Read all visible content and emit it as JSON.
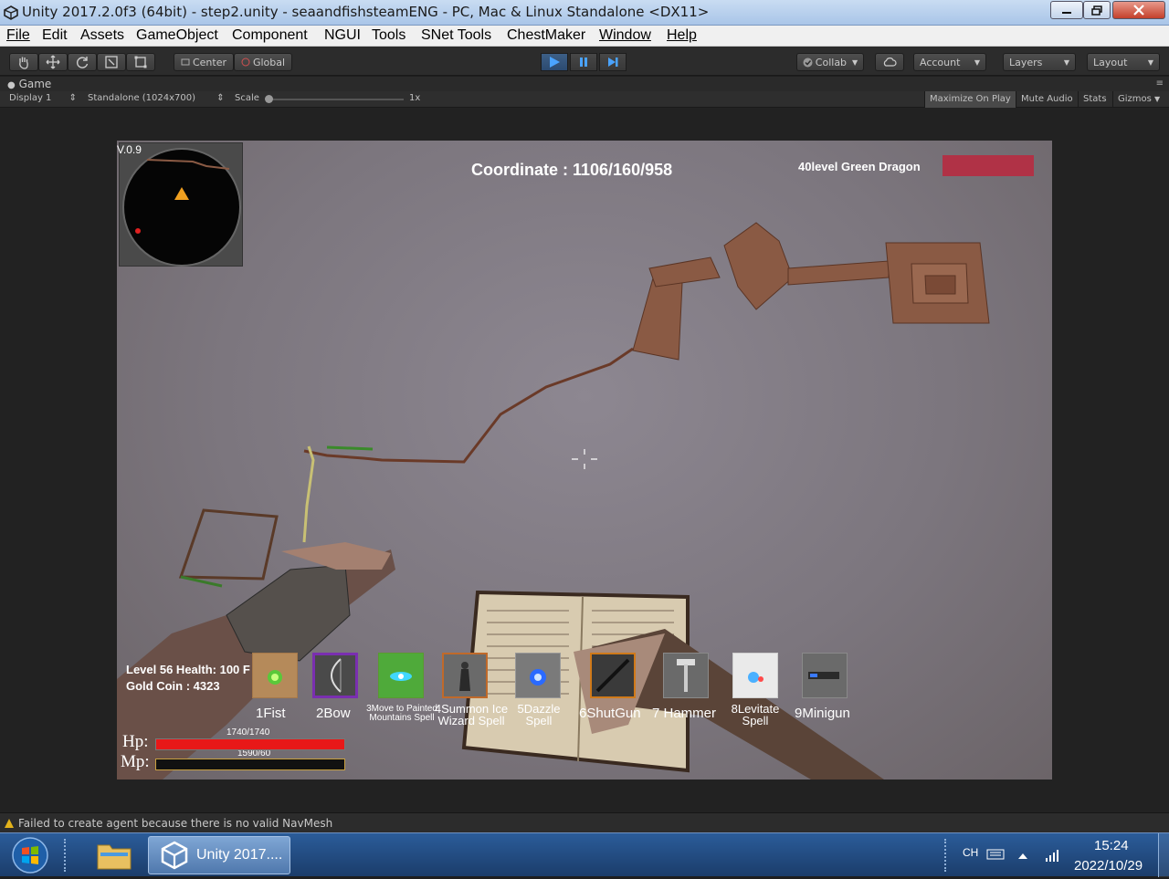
{
  "window": {
    "title": "Unity 2017.2.0f3 (64bit) - step2.unity - seaandfishsteamENG - PC, Mac & Linux Standalone <DX11>",
    "buttons": [
      "minimize",
      "maximize",
      "close"
    ]
  },
  "menu": [
    "File",
    "Edit",
    "Assets",
    "GameObject",
    "Component",
    "NGUI",
    "Tools",
    "SNet Tools",
    "ChestMaker",
    "Window",
    "Help"
  ],
  "toolbar": {
    "pivot": "Center",
    "space": "Global",
    "collab": "Collab",
    "account": "Account",
    "layers": "Layers",
    "layout": "Layout"
  },
  "game_view": {
    "tab": "Game",
    "display": "Display 1",
    "resolution": "Standalone (1024x700)",
    "scale_label": "Scale",
    "scale_value": "1x",
    "maximize_on_play": "Maximize On Play",
    "mute_audio": "Mute Audio",
    "stats": "Stats",
    "gizmos": "Gizmos"
  },
  "hud": {
    "version": "V.0.9",
    "coordinate": "Coordinate : 1106/160/958",
    "enemy": "40level Green Dragon",
    "enemy_health_color": "#b03246",
    "level_health": "Level 56 Health: 100 F",
    "gold": "Gold Coin : 4323",
    "hp_label": "Hp:",
    "mp_label": "Mp:",
    "hp_value": "1740/1740",
    "mp_value": "1590/60",
    "hp_fraction": 1.0,
    "mp_fraction": 0.0,
    "hp_color": "#e81818",
    "mp_color": "#1a2a9a",
    "slots": [
      {
        "label": "1Fist",
        "border": "#a6794a"
      },
      {
        "label": "2Bow",
        "border": "#7a2fb0"
      },
      {
        "label": "3Move to Painted Mountains Spell",
        "border": "#5a9a30"
      },
      {
        "label": "4Summon Ice Wizard Spell",
        "border": "#c06a2a"
      },
      {
        "label": "5Dazzle Spell",
        "border": "#9a9a9a"
      },
      {
        "label": "6ShutGun",
        "border": "#d07a1a"
      },
      {
        "label": "7 Hammer",
        "border": "#8a8a8a"
      },
      {
        "label": "8Levitate Spell",
        "border": "#cfcfcf"
      },
      {
        "label": "9Minigun",
        "border": "#8a8a8a"
      }
    ]
  },
  "console": {
    "message": "Failed to create agent because there is no valid NavMesh"
  },
  "taskbar": {
    "unity_task": "Unity 2017....",
    "lang": "CH",
    "time": "15:24",
    "date": "2022/10/29"
  }
}
